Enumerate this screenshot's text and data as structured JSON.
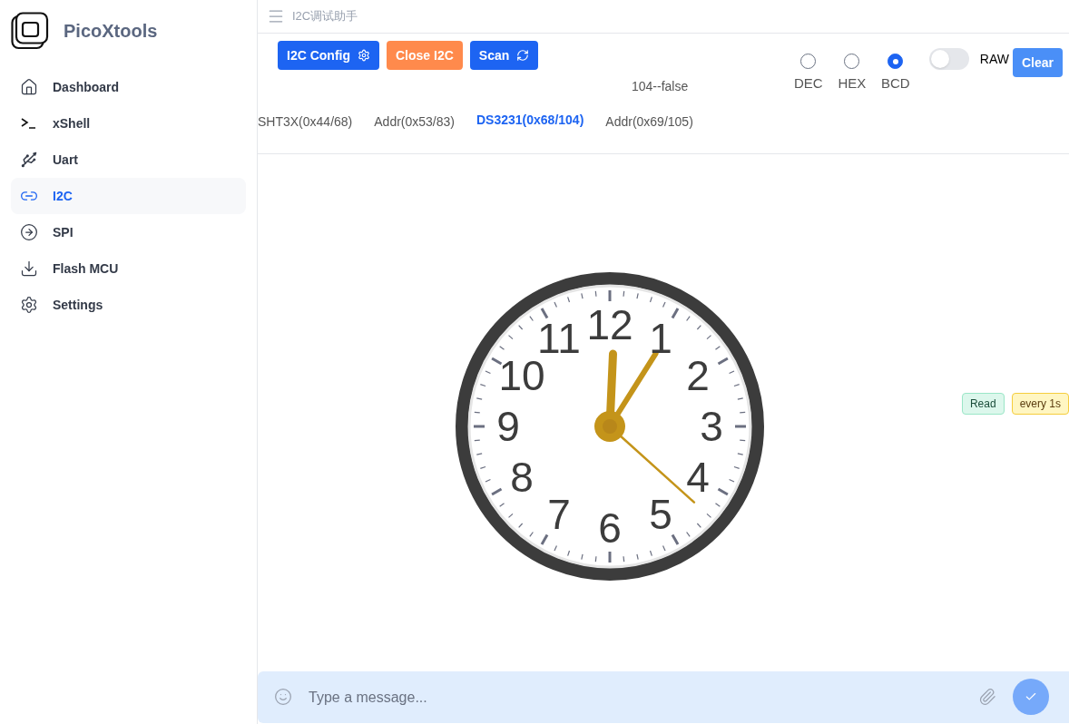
{
  "app": {
    "name": "PicoXtools"
  },
  "sidebar": {
    "items": [
      {
        "label": "Dashboard",
        "kind": "home",
        "selected": false
      },
      {
        "label": "xShell",
        "kind": "terminal",
        "selected": false
      },
      {
        "label": "Uart",
        "kind": "usb",
        "selected": false
      },
      {
        "label": "I2C",
        "kind": "link",
        "selected": true
      },
      {
        "label": "SPI",
        "kind": "arrow",
        "selected": false
      },
      {
        "label": "Flash MCU",
        "kind": "download",
        "selected": false
      },
      {
        "label": "Settings",
        "kind": "gear",
        "selected": false
      }
    ]
  },
  "header": {
    "title": "I2C调试助手"
  },
  "toolbar": {
    "buttons": [
      {
        "label": "I2C Config",
        "kind": "config"
      },
      {
        "label": "Close I2C",
        "kind": "close"
      },
      {
        "label": "Scan",
        "kind": "scan"
      }
    ],
    "formats": [
      {
        "label": "DEC",
        "selected": false
      },
      {
        "label": "HEX",
        "selected": false
      },
      {
        "label": "BCD",
        "selected": true
      }
    ],
    "raw": {
      "label": "RAW",
      "on": false
    },
    "clear": "Clear"
  },
  "status_text": "104--false",
  "tabs": [
    {
      "label": "SHT3X(0x44/68)",
      "selected": false
    },
    {
      "label": "Addr(0x53/83)",
      "selected": false
    },
    {
      "label": "DS3231(0x68/104)",
      "selected": true
    },
    {
      "label": "Addr(0x69/105)",
      "selected": false
    }
  ],
  "clock": {
    "numerals": [
      "12",
      "11",
      "1",
      "10",
      "2",
      "9",
      "3",
      "8",
      "4",
      "7",
      "5",
      "6"
    ]
  },
  "badges": [
    {
      "label": "Read",
      "kind": "mode"
    },
    {
      "label": "every 1s",
      "kind": "interval"
    }
  ],
  "composer": {
    "placeholder": "Type a message..."
  }
}
